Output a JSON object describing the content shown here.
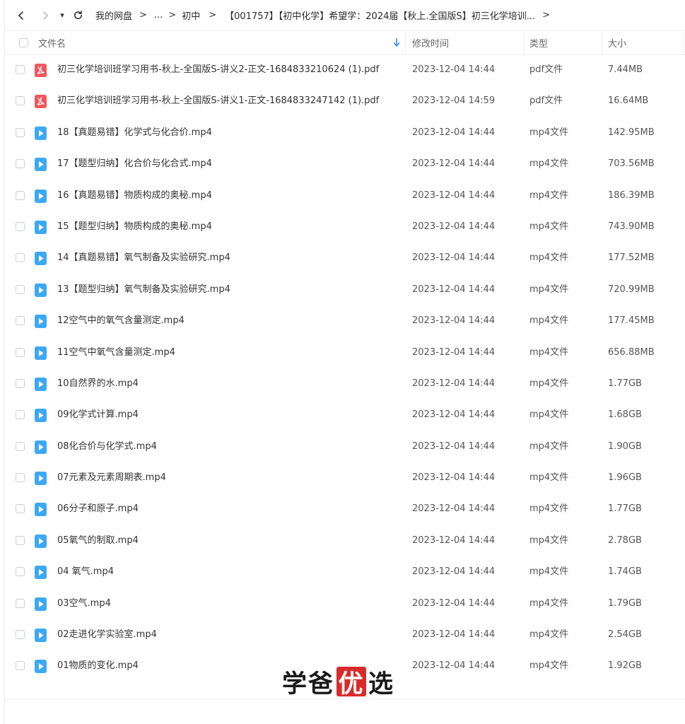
{
  "nav": {
    "dropdown_glyph": "▾"
  },
  "breadcrumb": {
    "items": [
      "我的网盘",
      "...",
      "初中",
      "【001757】【初中化学】希望学：2024届【秋上.全国版S】初三化学培训..."
    ],
    "separator": ">"
  },
  "table": {
    "headers": {
      "name": "文件名",
      "time": "修改时间",
      "type": "类型",
      "size": "大小"
    },
    "rows": [
      {
        "icon": "pdf-file-icon",
        "name": "初三化学培训班学习用书-秋上-全国版S-讲义2-正文-1684833210624 (1).pdf",
        "time": "2023-12-04 14:44",
        "type": "pdf文件",
        "size": "7.44MB"
      },
      {
        "icon": "pdf-file-icon",
        "name": "初三化学培训班学习用书-秋上-全国版S-讲义1-正文-1684833247142 (1).pdf",
        "time": "2023-12-04 14:59",
        "type": "pdf文件",
        "size": "16.64MB"
      },
      {
        "icon": "video-file-icon",
        "name": "18【真题易错】化学式与化合价.mp4",
        "time": "2023-12-04 14:44",
        "type": "mp4文件",
        "size": "142.95MB"
      },
      {
        "icon": "video-file-icon",
        "name": "17【题型归纳】化合价与化合式.mp4",
        "time": "2023-12-04 14:44",
        "type": "mp4文件",
        "size": "703.56MB"
      },
      {
        "icon": "video-file-icon",
        "name": "16【真题易错】物质构成的奥秘.mp4",
        "time": "2023-12-04 14:44",
        "type": "mp4文件",
        "size": "186.39MB"
      },
      {
        "icon": "video-file-icon",
        "name": "15【题型归纳】物质构成的奥秘.mp4",
        "time": "2023-12-04 14:44",
        "type": "mp4文件",
        "size": "743.90MB"
      },
      {
        "icon": "video-file-icon",
        "name": "14【真题易错】氧气制备及实验研究.mp4",
        "time": "2023-12-04 14:44",
        "type": "mp4文件",
        "size": "177.52MB"
      },
      {
        "icon": "video-file-icon",
        "name": "13【题型归纳】氧气制备及实验研究.mp4",
        "time": "2023-12-04 14:44",
        "type": "mp4文件",
        "size": "720.99MB"
      },
      {
        "icon": "video-file-icon",
        "name": "12空气中的氧气含量测定.mp4",
        "time": "2023-12-04 14:44",
        "type": "mp4文件",
        "size": "177.45MB"
      },
      {
        "icon": "video-file-icon",
        "name": "11空气中氧气含量测定.mp4",
        "time": "2023-12-04 14:44",
        "type": "mp4文件",
        "size": "656.88MB"
      },
      {
        "icon": "video-file-icon",
        "name": "10自然界的水.mp4",
        "time": "2023-12-04 14:44",
        "type": "mp4文件",
        "size": "1.77GB"
      },
      {
        "icon": "video-file-icon",
        "name": "09化学式计算.mp4",
        "time": "2023-12-04 14:44",
        "type": "mp4文件",
        "size": "1.68GB"
      },
      {
        "icon": "video-file-icon",
        "name": "08化合价与化学式.mp4",
        "time": "2023-12-04 14:44",
        "type": "mp4文件",
        "size": "1.90GB"
      },
      {
        "icon": "video-file-icon",
        "name": "07元素及元素周期表.mp4",
        "time": "2023-12-04 14:44",
        "type": "mp4文件",
        "size": "1.96GB"
      },
      {
        "icon": "video-file-icon",
        "name": "06分子和原子.mp4",
        "time": "2023-12-04 14:44",
        "type": "mp4文件",
        "size": "1.77GB"
      },
      {
        "icon": "video-file-icon",
        "name": "05氧气的制取.mp4",
        "time": "2023-12-04 14:44",
        "type": "mp4文件",
        "size": "2.78GB"
      },
      {
        "icon": "video-file-icon",
        "name": "04 氧气.mp4",
        "time": "2023-12-04 14:44",
        "type": "mp4文件",
        "size": "1.74GB"
      },
      {
        "icon": "video-file-icon",
        "name": "03空气.mp4",
        "time": "2023-12-04 14:44",
        "type": "mp4文件",
        "size": "1.79GB"
      },
      {
        "icon": "video-file-icon",
        "name": "02走进化学实验室.mp4",
        "time": "2023-12-04 14:44",
        "type": "mp4文件",
        "size": "2.54GB"
      },
      {
        "icon": "video-file-icon",
        "name": "01物质的变化.mp4",
        "time": "2023-12-04 14:44",
        "type": "mp4文件",
        "size": "1.92GB"
      }
    ]
  },
  "watermark": {
    "part1": "学爸",
    "highlight": "优",
    "part2": "选"
  },
  "colors": {
    "pdf_icon": "#f2555b",
    "video_icon": "#3da8f5",
    "sort_arrow": "#2f8ef4",
    "watermark_red": "#d92b2b"
  }
}
